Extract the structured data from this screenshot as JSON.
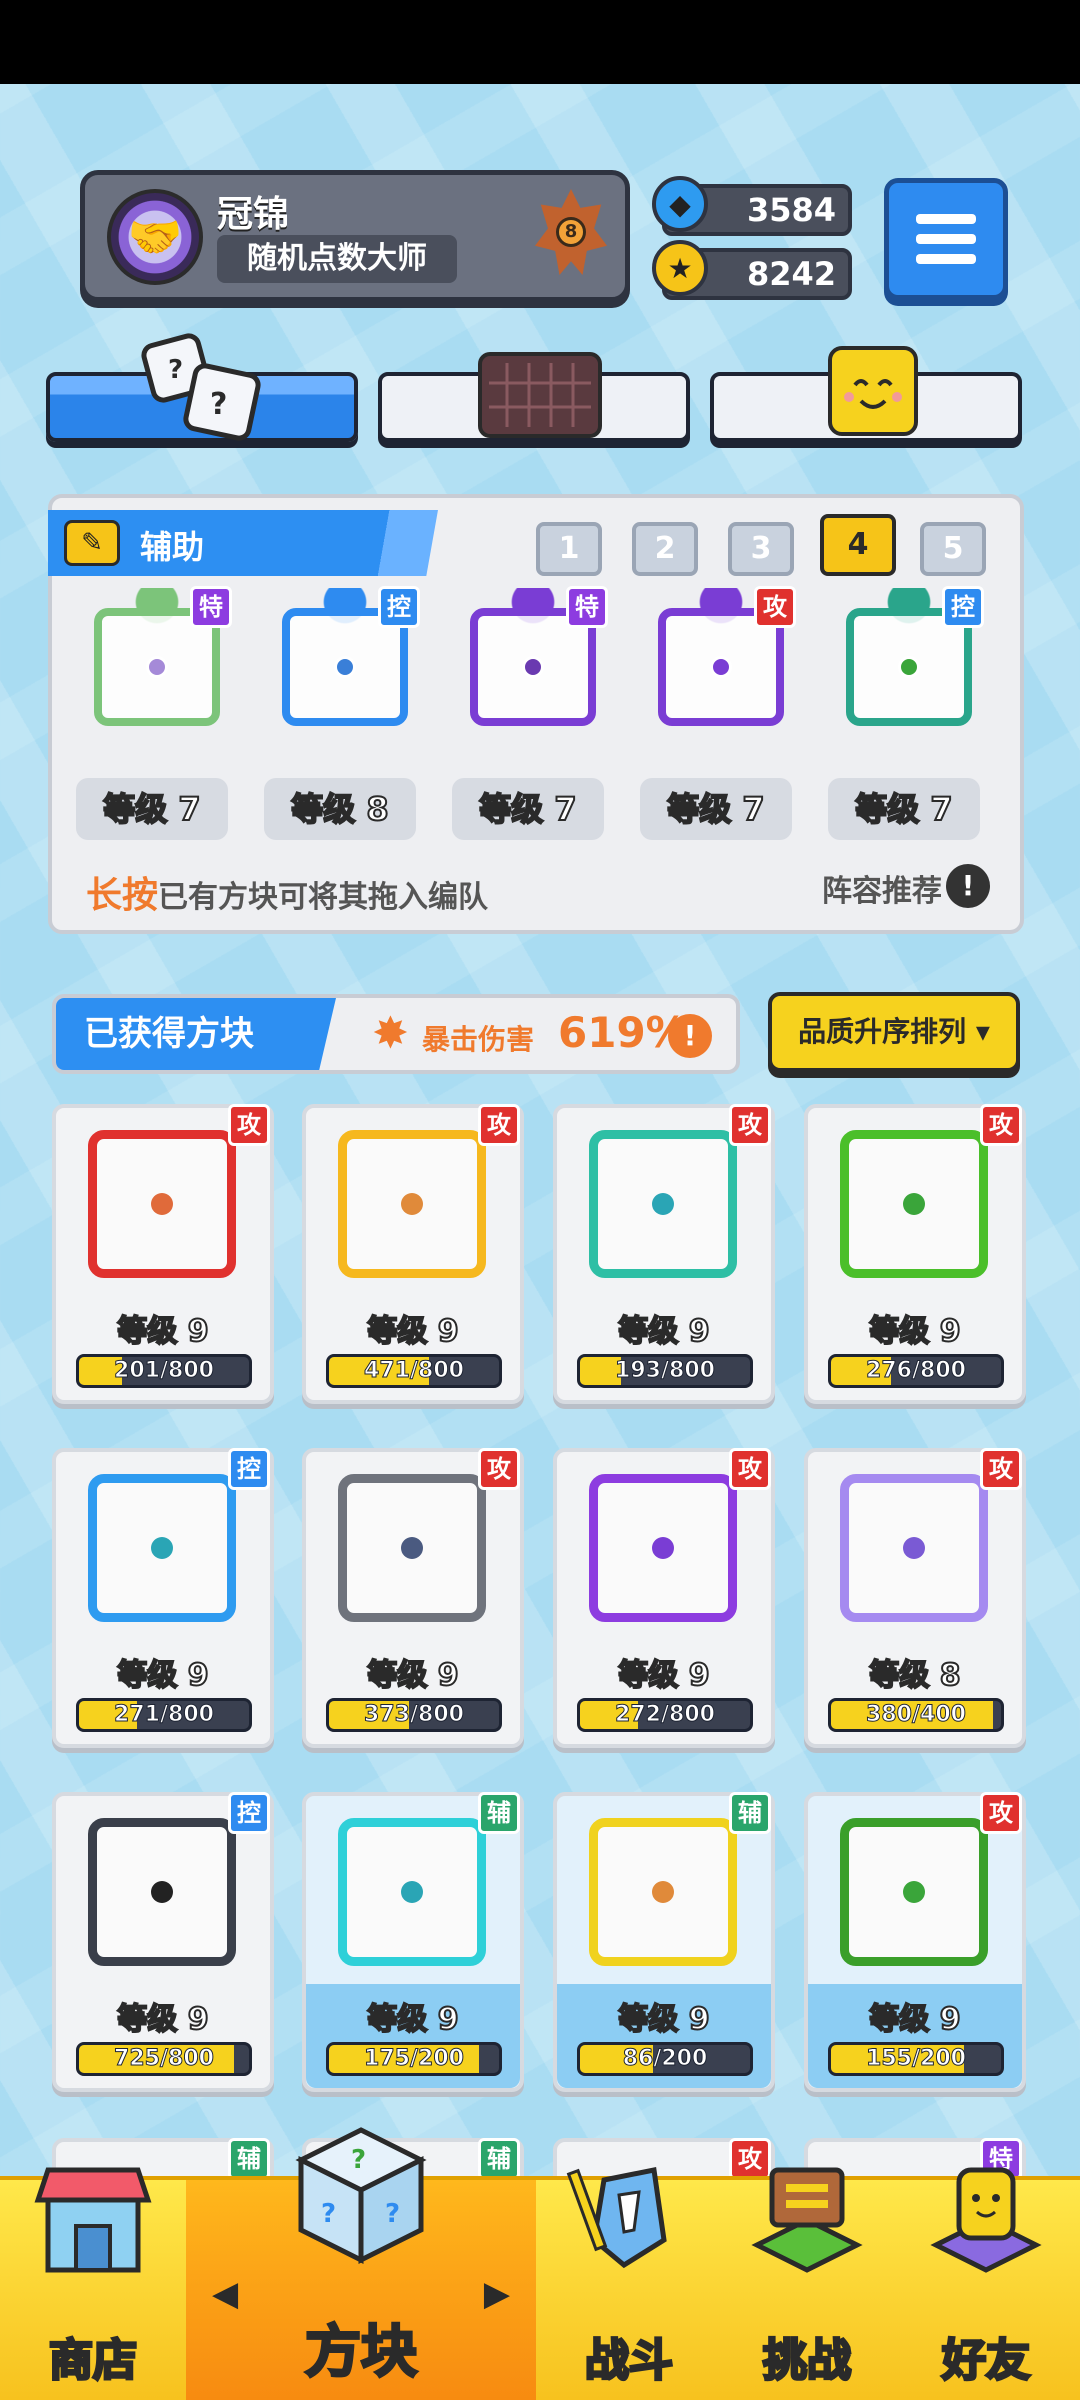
{
  "profile": {
    "name": "冠锦",
    "title": "随机点数大师",
    "rank_number": "8"
  },
  "currency": {
    "gems": "3584",
    "coins": "8242"
  },
  "tabs": [
    {
      "name": "dice",
      "active": true
    },
    {
      "name": "board",
      "active": false
    },
    {
      "name": "emoji",
      "active": false
    }
  ],
  "deck": {
    "header": "辅助",
    "numbers": [
      "1",
      "2",
      "3",
      "4",
      "5"
    ],
    "active_number": "4",
    "slots": [
      {
        "tag": "特",
        "tag_color": "purple",
        "frame": "#7cc47a",
        "dot": "#a58ad8",
        "level": "等级 7"
      },
      {
        "tag": "控",
        "tag_color": "blue",
        "frame": "#2e8bf0",
        "dot": "#3a7fd8",
        "level": "等级 8"
      },
      {
        "tag": "特",
        "tag_color": "purple",
        "frame": "#7a3dd4",
        "dot": "#6a3ab0",
        "level": "等级 7"
      },
      {
        "tag": "攻",
        "tag_color": "red",
        "frame": "#7a3dd4",
        "dot": "#7a3dd4",
        "level": "等级 7"
      },
      {
        "tag": "控",
        "tag_color": "blue",
        "frame": "#2aa58b",
        "dot": "#3aa53a",
        "level": "等级 7"
      }
    ],
    "hint_bold": "长按",
    "hint_rest": "已有方块可将其拖入编队",
    "lineup_label": "阵容推荐",
    "lineup_info": "!"
  },
  "obtained": {
    "title": "已获得方块",
    "crit_label": "暴击伤害",
    "crit_value": "619%",
    "crit_info": "!",
    "sort_label": "品质升序排列 ▾"
  },
  "cards": [
    {
      "tag": "攻",
      "tag_color": "red",
      "frame": "#e0312e",
      "dot": "#e06a3a",
      "level": "等级 9",
      "progress": "201/800",
      "ratio": 0.25,
      "light": false
    },
    {
      "tag": "攻",
      "tag_color": "red",
      "frame": "#f6b81e",
      "dot": "#e08a3a",
      "level": "等级 9",
      "progress": "471/800",
      "ratio": 0.59,
      "light": false
    },
    {
      "tag": "攻",
      "tag_color": "red",
      "frame": "#2ebfa5",
      "dot": "#2aa5b5",
      "level": "等级 9",
      "progress": "193/800",
      "ratio": 0.24,
      "light": false
    },
    {
      "tag": "攻",
      "tag_color": "red",
      "frame": "#4bbf2a",
      "dot": "#3aa53a",
      "level": "等级 9",
      "progress": "276/800",
      "ratio": 0.35,
      "light": false
    },
    {
      "tag": "控",
      "tag_color": "blue",
      "frame": "#2e9bf0",
      "dot": "#2aa5b5",
      "level": "等级 9",
      "progress": "271/800",
      "ratio": 0.34,
      "light": false
    },
    {
      "tag": "攻",
      "tag_color": "red",
      "frame": "#6f737c",
      "dot": "#4a5a80",
      "level": "等级 9",
      "progress": "373/800",
      "ratio": 0.47,
      "light": false
    },
    {
      "tag": "攻",
      "tag_color": "red",
      "frame": "#8d3ce0",
      "dot": "#7a3dd4",
      "level": "等级 9",
      "progress": "272/800",
      "ratio": 0.34,
      "light": false
    },
    {
      "tag": "攻",
      "tag_color": "red",
      "frame": "#a58af0",
      "dot": "#7a5ad4",
      "level": "等级 8",
      "progress": "380/400",
      "ratio": 0.95,
      "light": false
    },
    {
      "tag": "控",
      "tag_color": "blue",
      "frame": "#3a3f4a",
      "dot": "#222222",
      "level": "等级 9",
      "progress": "725/800",
      "ratio": 0.91,
      "light": false
    },
    {
      "tag": "辅",
      "tag_color": "green",
      "frame": "#2ed0d8",
      "dot": "#2aa5b5",
      "level": "等级 9",
      "progress": "175/200",
      "ratio": 0.88,
      "light": true
    },
    {
      "tag": "辅",
      "tag_color": "green",
      "frame": "#f0d21e",
      "dot": "#e08a3a",
      "level": "等级 9",
      "progress": "86/200",
      "ratio": 0.43,
      "light": true
    },
    {
      "tag": "攻",
      "tag_color": "red",
      "frame": "#3a9f2a",
      "dot": "#3aa53a",
      "level": "等级 9",
      "progress": "155/200",
      "ratio": 0.78,
      "light": true
    }
  ],
  "partial_tags": [
    {
      "tag": "辅",
      "tag_color": "green"
    },
    {
      "tag": "辅",
      "tag_color": "green"
    },
    {
      "tag": "攻",
      "tag_color": "red"
    },
    {
      "tag": "特",
      "tag_color": "purple"
    }
  ],
  "nav": {
    "shop": "商店",
    "blocks": "方块",
    "battle": "战斗",
    "challenge": "挑战",
    "friends": "好友",
    "arrow_left": "◀",
    "arrow_right": "▶"
  }
}
